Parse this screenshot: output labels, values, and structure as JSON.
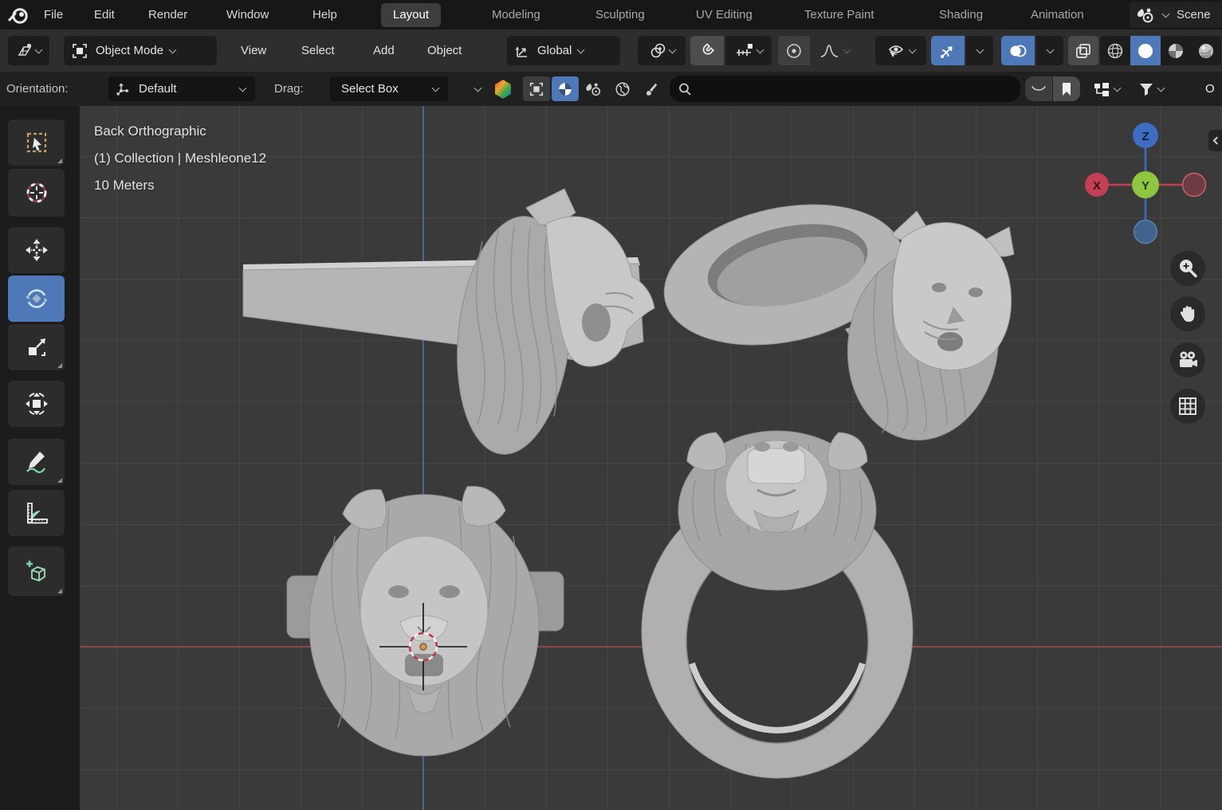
{
  "topbar": {
    "menus": [
      "File",
      "Edit",
      "Render",
      "Window",
      "Help"
    ],
    "workspaces": [
      {
        "label": "Layout",
        "active": true
      },
      {
        "label": "Modeling",
        "active": false
      },
      {
        "label": "Sculpting",
        "active": false
      },
      {
        "label": "UV Editing",
        "active": false
      },
      {
        "label": "Texture Paint",
        "active": false
      },
      {
        "label": "Shading",
        "active": false
      },
      {
        "label": "Animation",
        "active": false
      }
    ],
    "scene_label": "Scene"
  },
  "viewport_header": {
    "mode": "Object Mode",
    "menus": [
      "View",
      "Select",
      "Add",
      "Object"
    ],
    "orientation": "Global"
  },
  "tool_settings": {
    "orientation_label": "Orientation:",
    "orientation_value": "Default",
    "drag_label": "Drag:",
    "drag_value": "Select Box",
    "search_value": "",
    "clipped_right_text": "O"
  },
  "toolbar": {
    "tools": [
      "select-box",
      "cursor",
      "move",
      "rotate",
      "scale",
      "transform",
      "annotate",
      "measure",
      "add-cube"
    ],
    "active_tool": "rotate"
  },
  "viewport": {
    "overlay": [
      "Back Orthographic",
      "(1) Collection | Meshleone12",
      "10 Meters"
    ],
    "axis_labels": {
      "z": "Z",
      "x": "X",
      "y": "Y"
    }
  },
  "colors": {
    "accent_blue": "#4f78b8",
    "axis_x_red": "#c33f55",
    "axis_z_blue": "#3d6cc0",
    "viewport_bg": "#3a3a3a",
    "model_gray": "#b4b4b4",
    "annotate_green": "#7fd4a8"
  }
}
